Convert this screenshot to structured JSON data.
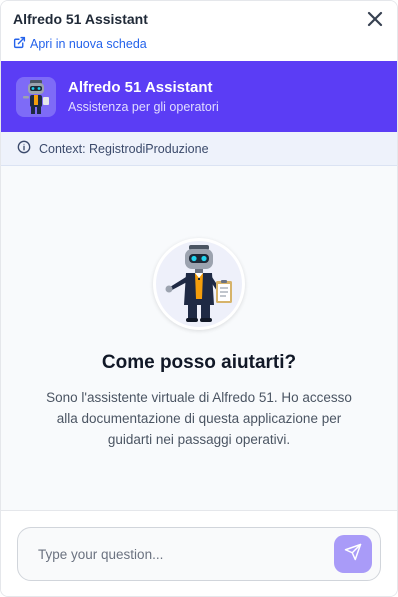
{
  "window": {
    "title": "Alfredo 51 Assistant",
    "open_new_tab": "Apri in nuova scheda"
  },
  "header": {
    "title": "Alfredo 51 Assistant",
    "subtitle": "Assistenza per gli operatori"
  },
  "context": {
    "text": "Context: RegistrodiProduzione"
  },
  "welcome": {
    "heading": "Come posso aiutarti?",
    "description": "Sono l'assistente virtuale di Alfredo 51. Ho accesso alla documentazione di questa applicazione per guidarti nei passaggi operativi."
  },
  "composer": {
    "placeholder": "Type your question..."
  },
  "colors": {
    "brand": "#5b3df5",
    "link": "#2563eb",
    "send_button": "#a99bf8",
    "context_bg": "#eef2fb"
  },
  "icons": {
    "external_link": "external-link-icon",
    "close": "close-icon",
    "info": "info-icon",
    "send": "send-icon",
    "avatar": "robot-avatar"
  }
}
